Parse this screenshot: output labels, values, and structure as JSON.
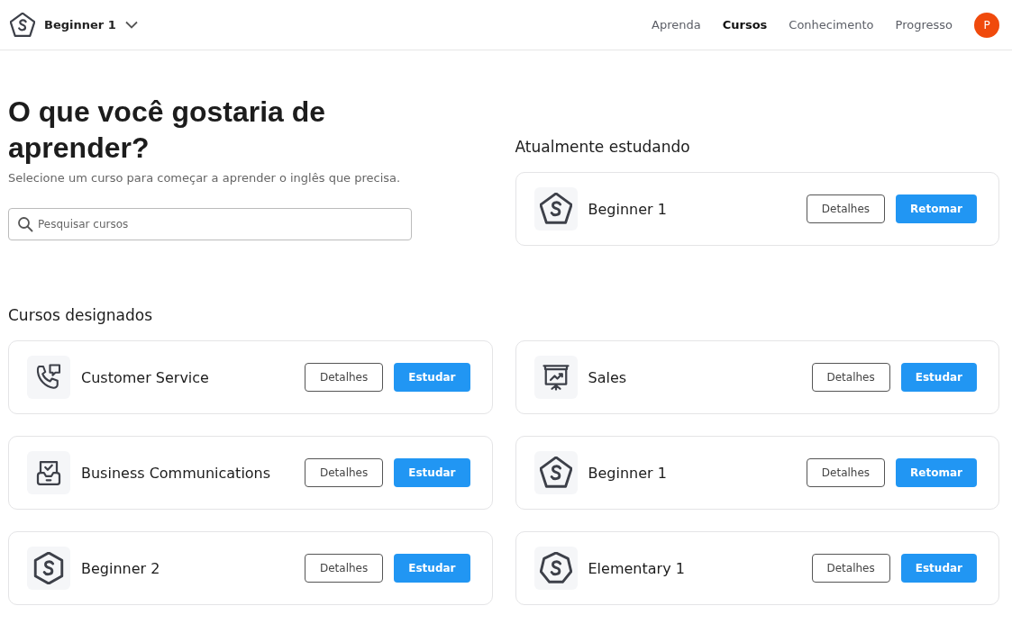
{
  "header": {
    "course_selector": {
      "label": "Beginner 1",
      "kind": "pentagon"
    },
    "nav": [
      {
        "label": "Aprenda",
        "selected": false
      },
      {
        "label": "Cursos",
        "selected": true
      },
      {
        "label": "Conhecimento",
        "selected": false
      },
      {
        "label": "Progresso",
        "selected": false
      }
    ],
    "avatar": "P"
  },
  "intro": {
    "title": "O que você gostaria de aprender?",
    "subtitle": "Selecione um curso para começar a aprender o inglês que precisa.",
    "search": {
      "placeholder": "Pesquisar cursos"
    }
  },
  "current": {
    "heading": "Atualmente estudando",
    "course": {
      "name": "Beginner 1",
      "kind": "pentagon",
      "details_label": "Detalhes",
      "action_label": "Retomar"
    }
  },
  "assigned": {
    "heading": "Cursos designados",
    "courses": [
      {
        "name": "Customer Service",
        "kind": "phone",
        "details_label": "Detalhes",
        "action_label": "Estudar"
      },
      {
        "name": "Sales",
        "kind": "presentation",
        "details_label": "Detalhes",
        "action_label": "Estudar"
      },
      {
        "name": "Business Communications",
        "kind": "inbox",
        "details_label": "Detalhes",
        "action_label": "Estudar"
      },
      {
        "name": "Beginner 1",
        "kind": "pentagon",
        "details_label": "Detalhes",
        "action_label": "Retomar"
      },
      {
        "name": "Beginner 2",
        "kind": "hexagon",
        "details_label": "Detalhes",
        "action_label": "Estudar"
      },
      {
        "name": "Elementary 1",
        "kind": "heptagon",
        "details_label": "Detalhes",
        "action_label": "Estudar"
      }
    ]
  }
}
